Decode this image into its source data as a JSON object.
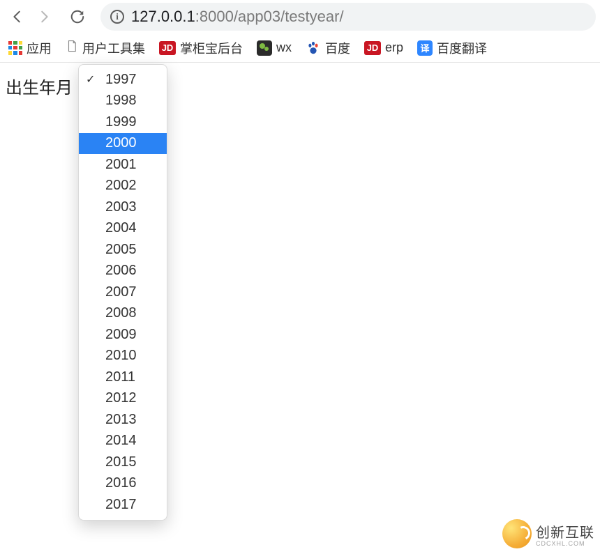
{
  "address": {
    "host": "127.0.0.1",
    "port": ":8000",
    "path": "/app03/testyear/"
  },
  "bookmarks": {
    "apps": "应用",
    "user_tools": "用户工具集",
    "zhanggui": "掌柜宝后台",
    "wx": "wx",
    "baidu": "百度",
    "erp": "erp",
    "baidu_translate": "百度翻译"
  },
  "page": {
    "field_label": "出生年月"
  },
  "dropdown": {
    "options": [
      "1997",
      "1998",
      "1999",
      "2000",
      "2001",
      "2002",
      "2003",
      "2004",
      "2005",
      "2006",
      "2007",
      "2008",
      "2009",
      "2010",
      "2011",
      "2012",
      "2013",
      "2014",
      "2015",
      "2016",
      "2017"
    ],
    "selected": "1997",
    "highlighted": "2000"
  },
  "watermark": {
    "brand": "创新互联",
    "sub": "CDCXHL.COM"
  }
}
